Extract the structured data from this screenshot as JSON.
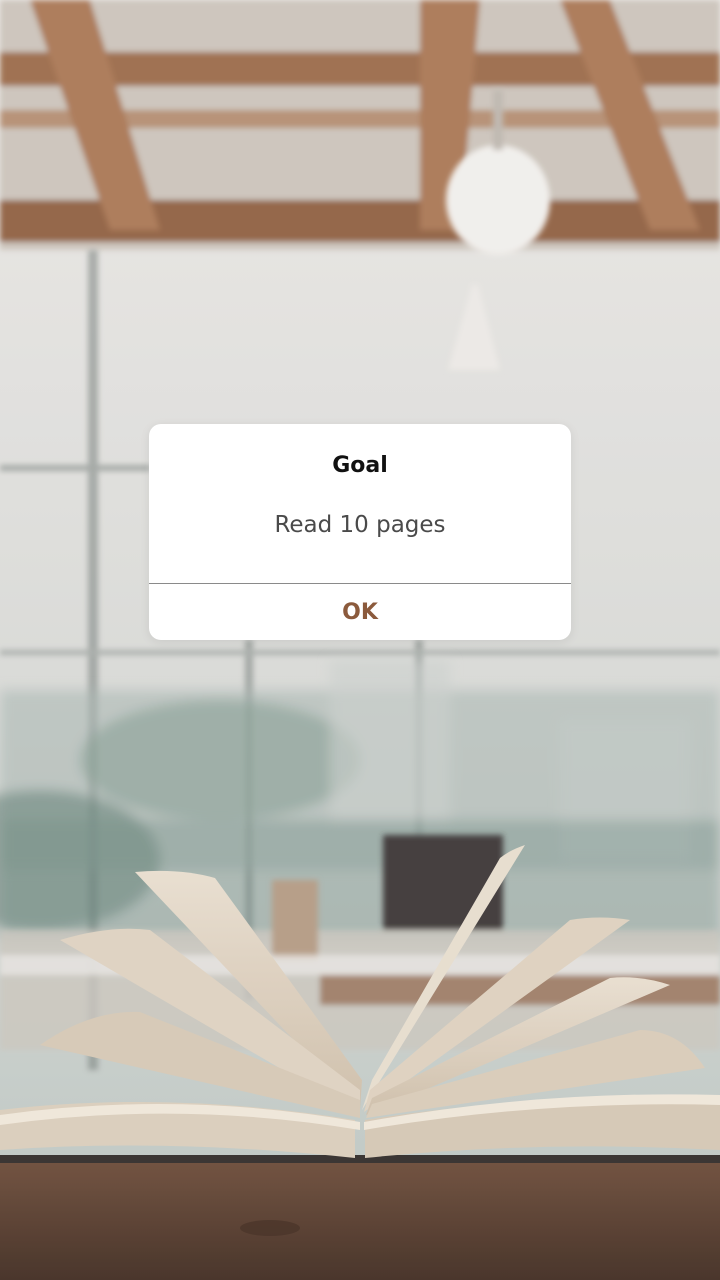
{
  "dialog": {
    "title": "Goal",
    "message": "Read 10 pages",
    "ok_label": "OK"
  },
  "colors": {
    "ok_text": "#8b5a3c",
    "dialog_bg": "#ffffff",
    "title_text": "#111111",
    "message_text": "#4a4a4a"
  },
  "background": {
    "description_icon": "open-book-photo"
  }
}
